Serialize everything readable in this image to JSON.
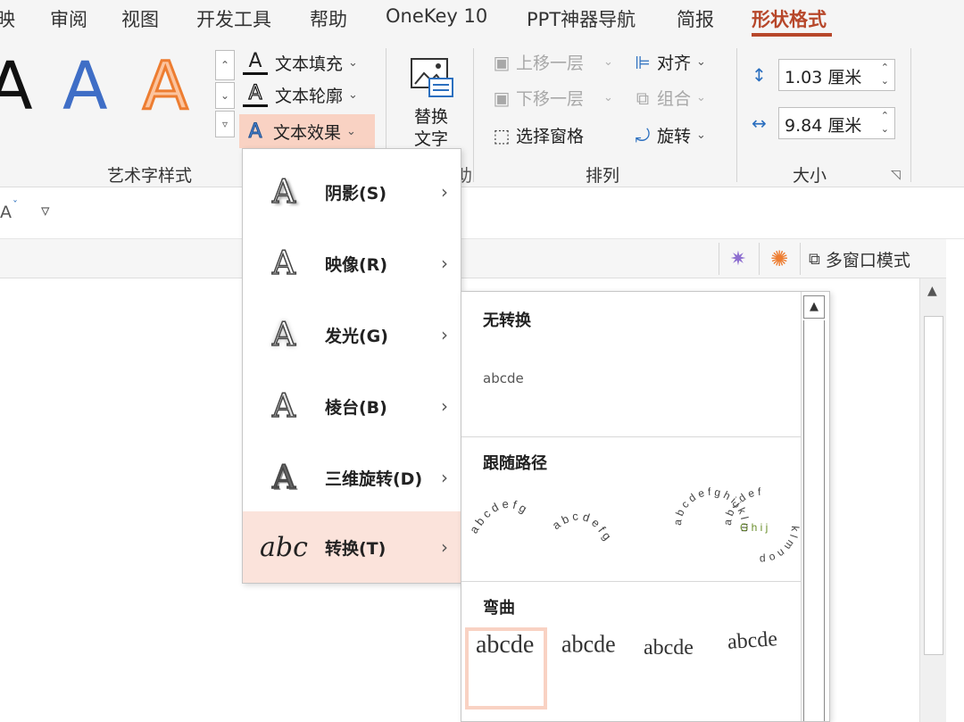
{
  "tabs": [
    {
      "label": "映",
      "active": false
    },
    {
      "label": "审阅",
      "active": false
    },
    {
      "label": "视图",
      "active": false
    },
    {
      "label": "开发工具",
      "active": false
    },
    {
      "label": "帮助",
      "active": false
    },
    {
      "label": "OneKey 10",
      "active": false
    },
    {
      "label": "PPT神器导航",
      "active": false
    },
    {
      "label": "简报",
      "active": false
    },
    {
      "label": "形状格式",
      "active": true
    }
  ],
  "ribbon": {
    "wordart": {
      "samples": [
        "A",
        "A",
        "A"
      ],
      "text_fill": "文本填充",
      "text_outline": "文本轮廓",
      "text_effect": "文本效果",
      "group_label": "艺术字样式"
    },
    "alt_text": {
      "line1": "替换",
      "line2": "文字"
    },
    "arrange": {
      "bring_forward": "上移一层",
      "send_backward": "下移一层",
      "selection_pane": "选择窗格",
      "align": "对齐",
      "group": "组合",
      "rotate": "旋转",
      "group_label": "排列",
      "partial_label": "助"
    },
    "size": {
      "height": "1.03 厘米",
      "width": "9.84 厘米",
      "group_label": "大小"
    }
  },
  "toolbar2": {
    "font_size_btn": "A",
    "more": "▿"
  },
  "infobar": {
    "multi_window": "多窗口模式"
  },
  "menu": {
    "items": [
      {
        "label": "阴影(S)"
      },
      {
        "label": "映像(R)"
      },
      {
        "label": "发光(G)"
      },
      {
        "label": "棱台(B)"
      },
      {
        "label": "三维旋转(D)"
      },
      {
        "label": "转换(T)"
      }
    ]
  },
  "submenu": {
    "no_transform": {
      "title": "无转换",
      "sample": "abcde"
    },
    "follow_path": {
      "title": "跟随路径"
    },
    "warp": {
      "title": "弯曲",
      "samples": [
        "abcde",
        "abcde",
        "abcde",
        "abcde"
      ]
    }
  },
  "colors": {
    "accent": "#b7472a",
    "highlight": "#f9d2c3",
    "wordart_blue": "#3f6ec6",
    "wordart_orange": "#ed7d31"
  }
}
